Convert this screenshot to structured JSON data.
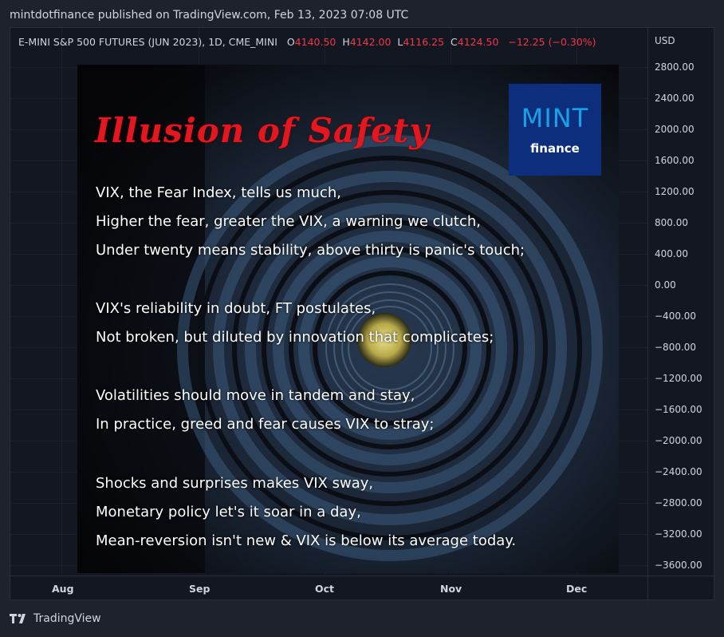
{
  "publisher_line": "mintdotfinance published on TradingView.com, Feb 13, 2023 07:08 UTC",
  "legend": {
    "symbol": "E-MINI S&P 500 FUTURES (JUN 2023), 1D, CME_MINI",
    "open_label": "O",
    "open_value": "4140.50",
    "high_label": "H",
    "high_value": "4142.00",
    "low_label": "L",
    "low_value": "4116.25",
    "close_label": "C",
    "close_value": "4124.50",
    "change": "−12.25 (−0.30%)"
  },
  "price_axis": {
    "currency": "USD",
    "ticks": [
      "2800.00",
      "2400.00",
      "2000.00",
      "1600.00",
      "1200.00",
      "800.00",
      "400.00",
      "0.00",
      "−400.00",
      "−800.00",
      "−1200.00",
      "−1600.00",
      "−2000.00",
      "−2400.00",
      "−2800.00",
      "−3200.00",
      "−3600.00"
    ]
  },
  "time_axis": {
    "ticks": [
      "Aug",
      "Sep",
      "Oct",
      "Nov",
      "Dec"
    ]
  },
  "overlay": {
    "title": "Illusion of Safety",
    "logo_word": "MINT",
    "logo_sub": "finance",
    "poem": [
      "VIX, the Fear Index, tells us much,",
      "Higher the fear, greater the VIX, a warning we clutch,",
      "Under twenty means stability, above thirty is panic's touch;",
      "VIX's reliability in doubt, FT postulates,",
      "Not broken, but diluted by innovation that complicates;",
      "Volatilities should move in tandem and stay,",
      "In practice, greed and fear causes VIX to stray;",
      "Shocks and surprises makes VIX sway,",
      "Monetary policy let's it soar in a day,",
      "Mean-reversion isn't new & VIX is below its average today."
    ]
  },
  "branding": {
    "name": "TradingView"
  },
  "colors": {
    "down": "#f23645",
    "background": "#131722",
    "title_red": "#e3171f",
    "logo_blue": "#0d2e7d"
  }
}
